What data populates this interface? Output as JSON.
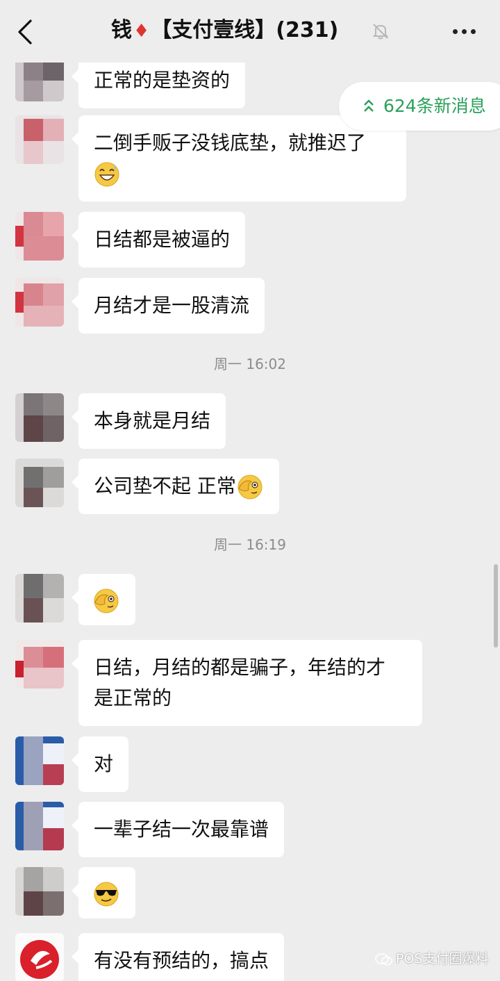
{
  "header": {
    "title_prefix": "钱",
    "title_diamond": "♦",
    "title_group": "【支付壹线】(231)",
    "back_icon": "back-chevron-icon",
    "mute_icon": "bell-off-icon",
    "more_icon": "more-dots-icon"
  },
  "new_messages": {
    "label": "624条新消息",
    "icon": "double-chevron-up-icon",
    "color": "#2aa05a"
  },
  "messages": [
    {
      "text": "正常的是垫资的"
    },
    {
      "text": "二倒手贩子没钱底垫，就推迟了",
      "emoji": "grinning-sweat-emoji"
    },
    {
      "text": "日结都是被逼的"
    },
    {
      "text": "月结才是一股清流"
    },
    {
      "time": "周一 16:02"
    },
    {
      "text": "本身就是月结"
    },
    {
      "text": "公司垫不起 正常",
      "emoji": "facepalm-emoji"
    },
    {
      "time": "周一 16:19"
    },
    {
      "text": "",
      "emoji": "facepalm-emoji"
    },
    {
      "line1": "日结，月结的都是骗子，年结的才",
      "line2": "是正常的"
    },
    {
      "text": "对"
    },
    {
      "text": "一辈子结一次最靠谱"
    },
    {
      "text": "",
      "emoji": "sunglasses-emoji"
    },
    {
      "text": "有没有预结的，搞点"
    }
  ],
  "watermark": {
    "text": "POS支付圈爆料"
  }
}
